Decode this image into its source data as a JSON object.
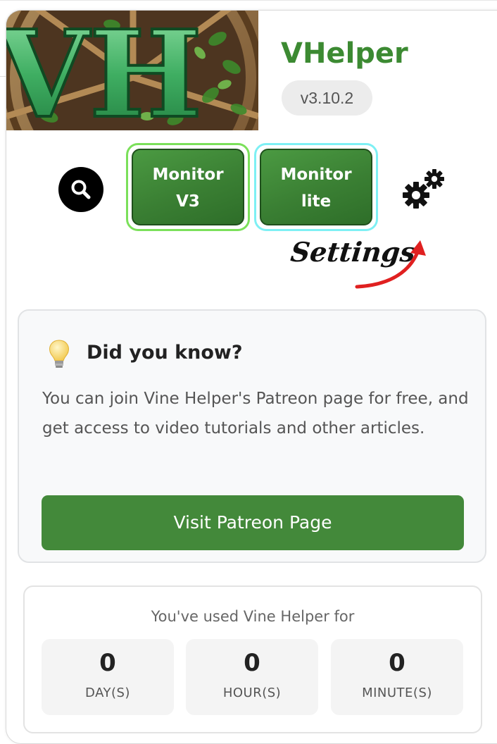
{
  "header": {
    "app_title": "VHelper",
    "version": "v3.10.2",
    "logo_letters": "VH"
  },
  "toolbar": {
    "search_icon": "search-icon",
    "monitor_v3_line1": "Monitor",
    "monitor_v3_line2": "V3",
    "monitor_lite_line1": "Monitor",
    "monitor_lite_line2": "lite",
    "settings_icon": "gears-icon",
    "settings_annotation": "Settings"
  },
  "tip": {
    "icon": "lightbulb-icon",
    "title": "Did you know?",
    "text": "You can join Vine Helper's Patreon page for free, and get access to video tutorials and other articles.",
    "button_label": "Visit Patreon Page"
  },
  "usage": {
    "title": "You've used Vine Helper for",
    "stats": [
      {
        "value": "0",
        "label": "DAY(S)"
      },
      {
        "value": "0",
        "label": "HOUR(S)"
      },
      {
        "value": "0",
        "label": "MINUTE(S)"
      }
    ]
  },
  "colors": {
    "brand_green": "#3c8a32",
    "button_green": "#43893a",
    "monitor_v3_outline": "#7be05a",
    "monitor_lite_outline": "#7ef0f4",
    "annotation_arrow": "#e02020"
  }
}
